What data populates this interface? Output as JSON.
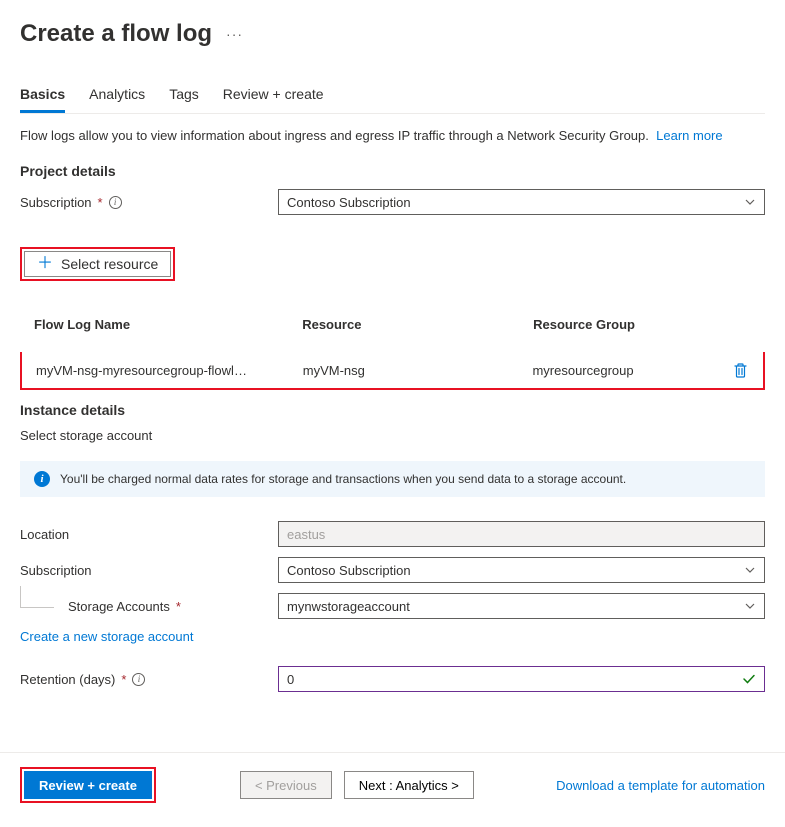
{
  "header": {
    "title": "Create a flow log"
  },
  "tabs": {
    "items": [
      {
        "label": "Basics",
        "active": true
      },
      {
        "label": "Analytics",
        "active": false
      },
      {
        "label": "Tags",
        "active": false
      },
      {
        "label": "Review + create",
        "active": false
      }
    ]
  },
  "description": {
    "text": "Flow logs allow you to view information about ingress and egress IP traffic through a Network Security Group.",
    "learn_more": "Learn more"
  },
  "project_details": {
    "heading": "Project details",
    "subscription_label": "Subscription",
    "subscription_value": "Contoso Subscription",
    "select_resource_label": "Select resource"
  },
  "resource_table": {
    "headers": {
      "name": "Flow Log Name",
      "resource": "Resource",
      "group": "Resource Group"
    },
    "rows": [
      {
        "name": "myVM-nsg-myresourcegroup-flowl…",
        "resource": "myVM-nsg",
        "group": "myresourcegroup"
      }
    ]
  },
  "instance_details": {
    "heading": "Instance details",
    "subhead": "Select storage account",
    "banner": "You'll be charged normal data rates for storage and transactions when you send data to a storage account.",
    "location_label": "Location",
    "location_value": "eastus",
    "subscription_label": "Subscription",
    "subscription_value": "Contoso Subscription",
    "storage_label": "Storage Accounts",
    "storage_value": "mynwstorageaccount",
    "new_storage_link": "Create a new storage account",
    "retention_label": "Retention (days)",
    "retention_value": "0"
  },
  "footer": {
    "review_label": "Review + create",
    "prev_label": "< Previous",
    "next_label": "Next : Analytics >",
    "download_label": "Download a template for automation"
  }
}
